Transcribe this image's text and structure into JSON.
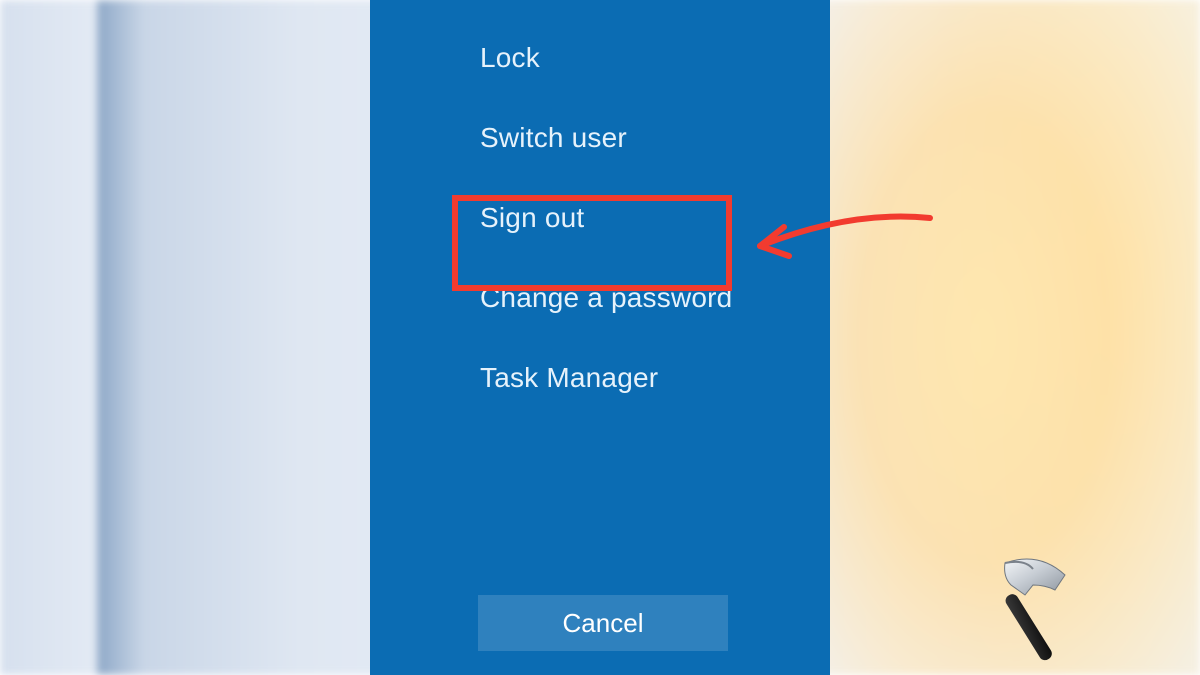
{
  "menu": {
    "options": [
      {
        "label": "Lock"
      },
      {
        "label": "Switch user"
      },
      {
        "label": "Sign out"
      },
      {
        "label": "Change a password"
      },
      {
        "label": "Task Manager"
      }
    ],
    "cancel_label": "Cancel"
  },
  "annotation": {
    "highlight_color": "#f23b2f",
    "arrow_color": "#f23b2f"
  }
}
